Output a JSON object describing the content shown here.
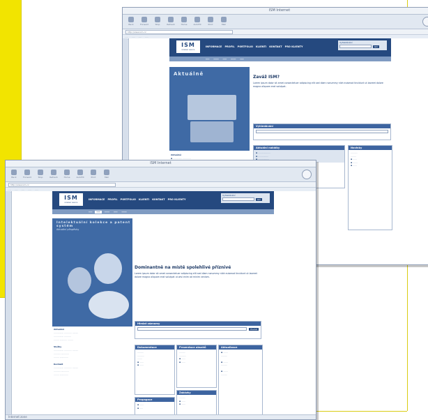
{
  "browser": {
    "toolbar_labels": [
      "Back",
      "Forward",
      "Stop",
      "Refresh",
      "Home",
      "AutoFill",
      "Print",
      "Mail"
    ],
    "address": "http://www.ism.cz"
  },
  "site": {
    "logo": "ISM",
    "logo_tagline": "INTERNET SERVICE",
    "nav": [
      "INFORMACE",
      "PROFIL",
      "PORTFOLIO",
      "KLIENTI",
      "KONTAKT",
      "PRO KLIENTY"
    ],
    "search_label": "Vyhledávání",
    "search_button": "GO"
  },
  "back_window": {
    "title": "ISM Internet",
    "hero_title": "Aktuálně",
    "main_title": "Zaváž ISM?",
    "main_text": "Lorem ipsum dolor sit amet consectetuer adipiscing elit sed diam nonummy nibh euismod tincidunt ut laoreet dolore magna aliquam erat volutpat.",
    "panel_search": "Vyhledávání",
    "panel_news": "Aktuální nabídky",
    "panel_right": "Novinky",
    "left_label": "Aktuálně"
  },
  "front_window": {
    "title": "ISM Internet",
    "hero_title": "Intelektuální kolekce a patent systém",
    "hero_subtitle": "Aktuální příspěvky",
    "main_title": "Dominantně na místě spolehlivé příznivé",
    "main_text": "Lorem ipsum dolor sit amet consectetuer adipiscing elit sed diam nonummy nibh euismod tincidunt ut laoreet dolore magna aliquam erat volutpat ut wisi enim ad minim veniam.",
    "search_panel": "Hledat záznamy",
    "search_button": "Hledat",
    "panels": [
      "Dokumentace",
      "Prezentace obsahů",
      "Aktualizace",
      "Propagace",
      "Zakázky"
    ],
    "left_labels": [
      "Aktuálně",
      "Služby",
      "Kontakt"
    ],
    "status": "Internet zone"
  }
}
